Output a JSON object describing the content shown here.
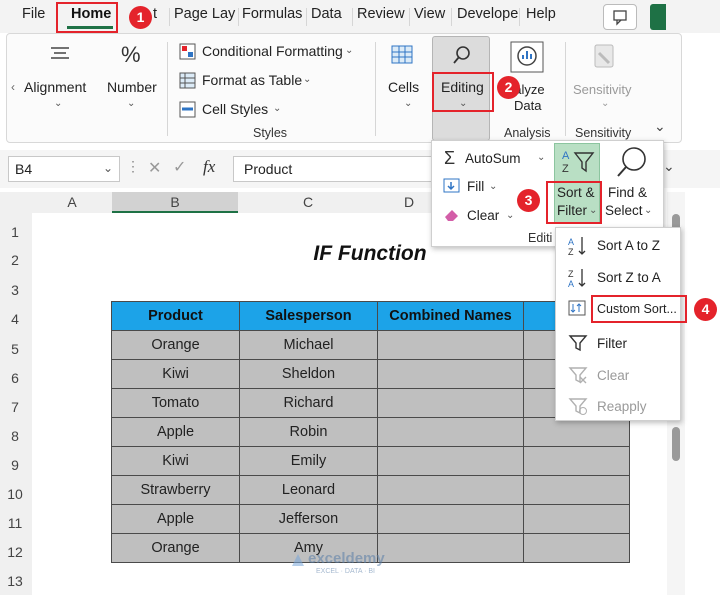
{
  "tabs": [
    "File",
    "Home",
    "t",
    "Page Lay",
    "Formulas",
    "Data",
    "Review",
    "View",
    "Develope",
    "Help"
  ],
  "ribbon": {
    "alignment": "Alignment",
    "number": "Number",
    "number_icon": "%",
    "cond_format": "Conditional Formatting",
    "format_table": "Format as Table",
    "cell_styles": "Cell Styles",
    "styles_group": "Styles",
    "cells": "Cells",
    "editing": "Editing",
    "analyze_1": "nalyze",
    "analyze_2": "Data",
    "analysis_group": "Analysis",
    "sensitivity": "Sensitivity",
    "sensitivity_group": "Sensitivity"
  },
  "formula_bar": {
    "name_box": "B4",
    "fx": "fx",
    "formula": "Product"
  },
  "editing_menu": {
    "autosum": "AutoSum",
    "fill": "Fill",
    "clear": "Clear",
    "sort_filter_1": "Sort &",
    "sort_filter_2": "Filter",
    "find_select_1": "Find &",
    "find_select_2": "Select",
    "group": "Editi"
  },
  "sort_menu": {
    "items": [
      "Sort A to Z",
      "Sort Z to A",
      "Custom Sort...",
      "Filter",
      "Clear",
      "Reapply"
    ]
  },
  "badges": [
    "1",
    "2",
    "3",
    "4"
  ],
  "columns": [
    "A",
    "B",
    "C",
    "D"
  ],
  "rows": [
    "1",
    "2",
    "3",
    "4",
    "5",
    "6",
    "7",
    "8",
    "9",
    "10",
    "11",
    "12",
    "13"
  ],
  "sheet": {
    "title": "IF Function",
    "headers": [
      "Product",
      "Salesperson",
      "Combined Names",
      ""
    ],
    "data": [
      [
        "Orange",
        "Michael"
      ],
      [
        "Kiwi",
        "Sheldon"
      ],
      [
        "Tomato",
        "Richard"
      ],
      [
        "Apple",
        "Robin"
      ],
      [
        "Kiwi",
        "Emily"
      ],
      [
        "Strawberry",
        "Leonard"
      ],
      [
        "Apple",
        "Jefferson"
      ],
      [
        "Orange",
        "Amy"
      ]
    ]
  },
  "watermark": {
    "name": "exceldemy",
    "tagline": "EXCEL · DATA · BI"
  },
  "colors": {
    "header_fill": "#1ca3e8",
    "cell_fill": "#bfbfbf",
    "highlight": "#e4232b",
    "selected_button": "#b9dfc4"
  }
}
